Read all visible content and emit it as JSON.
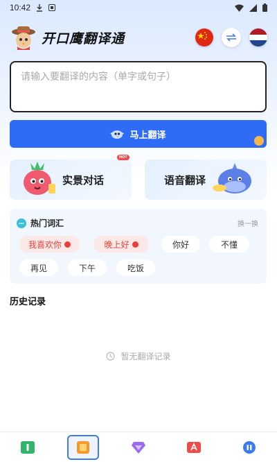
{
  "status_bar": {
    "time": "10:42"
  },
  "header": {
    "app_title": "开口鹰翻译通"
  },
  "input": {
    "placeholder": "请输入要翻译的内容（单字或句子）"
  },
  "translate_button": {
    "label": "马上翻译"
  },
  "features": {
    "scene_dialog_label": "实景对话",
    "hot_badge": "HOT",
    "voice_translate_label": "语音翻译"
  },
  "hot_words": {
    "title": "热门词汇",
    "refresh_label": "换一换",
    "chips": [
      {
        "label": "我喜欢你",
        "hot": true
      },
      {
        "label": "晚上好",
        "hot": true
      },
      {
        "label": "你好",
        "hot": false
      },
      {
        "label": "不懂",
        "hot": false
      },
      {
        "label": "再见",
        "hot": false
      },
      {
        "label": "下午",
        "hot": false
      },
      {
        "label": "吃饭",
        "hot": false
      }
    ]
  },
  "history": {
    "title": "历史记录",
    "empty_text": "暂无翻译记录"
  },
  "colors": {
    "accent": "#2f6cf5",
    "hot_text": "#e0453c",
    "hot_bg": "#fde8e8"
  },
  "icons": {
    "languages": [
      "china-flag-icon",
      "swap-arrows-icon",
      "netherlands-flag-icon"
    ],
    "tabs": [
      "translate-tab-icon",
      "phrasebook-tab-icon",
      "gem-tab-icon",
      "dictionary-tab-icon",
      "profile-tab-icon"
    ]
  }
}
